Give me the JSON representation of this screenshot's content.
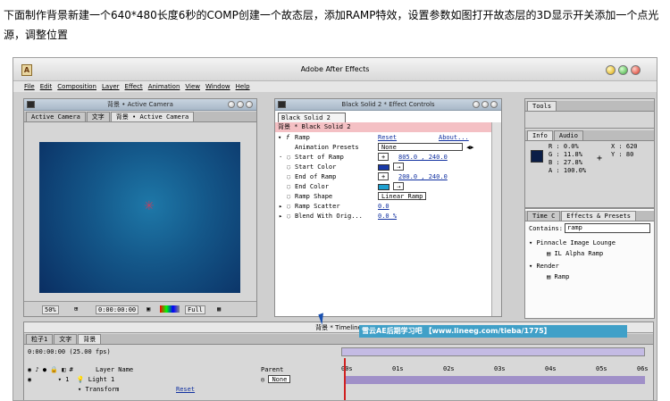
{
  "instruction": "下面制作背景新建一个640*480长度6秒的COMP创建一个故态层，添加RAMP特效，设置参数如图打开故态层的3D显示开关添加一个点光源，调整位置",
  "app": {
    "title": "Adobe After Effects",
    "logo": "A",
    "menu": [
      "File",
      "Edit",
      "Composition",
      "Layer",
      "Effect",
      "Animation",
      "View",
      "Window",
      "Help"
    ]
  },
  "comp_panel": {
    "title": "背景 • Active Camera",
    "tabs": [
      "Active Camera",
      "文字",
      "背景 • Active Camera"
    ],
    "zoom": "50%",
    "timecode": "0:00:00:00",
    "resolution": "Full",
    "crosshair": "✳"
  },
  "effect_controls": {
    "title": "Black Solid 2 * Effect Controls",
    "tab": "Black Solid 2",
    "layer_line": "背景 * Black Solid 2",
    "effect_name": "Ramp",
    "reset": "Reset",
    "about": "About...",
    "rows": [
      {
        "label": "Animation Presets",
        "value": "None"
      },
      {
        "label": "Start of Ramp",
        "value": "805.0 , 240.0"
      },
      {
        "label": "Start Color",
        "value": ""
      },
      {
        "label": "End of Ramp",
        "value": "200.0 , 240.0"
      },
      {
        "label": "End Color",
        "value": ""
      },
      {
        "label": "Ramp Shape",
        "value": "Linear Ramp"
      },
      {
        "label": "Ramp Scatter",
        "value": "0.0"
      },
      {
        "label": "Blend With Orig...",
        "value": "0.0 %"
      }
    ],
    "start_color": "#1a3aa8",
    "end_color": "#1ea0d0"
  },
  "tools": {
    "title": "Tools"
  },
  "info": {
    "tabs": [
      "Info",
      "Audio"
    ],
    "R": "R :  0.0%",
    "G": "G : 11.8%",
    "B": "B : 27.8%",
    "A": "A : 100.0%",
    "X": "X :  620",
    "Y": "Y :   80",
    "color": "#0b1e47"
  },
  "effects_presets": {
    "tabs": [
      "Time C",
      "Effects & Presets"
    ],
    "contains_label": "Contains:",
    "contains_value": "ramp",
    "items": [
      "Pinnacle Image Lounge",
      "IL Alpha Ramp",
      "Render",
      "Ramp"
    ]
  },
  "timeline": {
    "title": "背景 * Timeline",
    "tabs": [
      "粒子1",
      "文字",
      "背景"
    ],
    "timecode": "0:00:00:00",
    "fps": "(25.00 fps)",
    "columns": {
      "layer_name": "Layer Name",
      "parent": "Parent"
    },
    "layer": {
      "num": "1",
      "name": "Light 1",
      "parent": "None"
    },
    "transform": "Transform",
    "reset": "Reset",
    "ruler": [
      "00s",
      "01s",
      "02s",
      "03s",
      "04s",
      "05s",
      "06s"
    ]
  },
  "watermark": "雪云AE后期学习吧 【www.lineeg.com/tieba/1775】"
}
